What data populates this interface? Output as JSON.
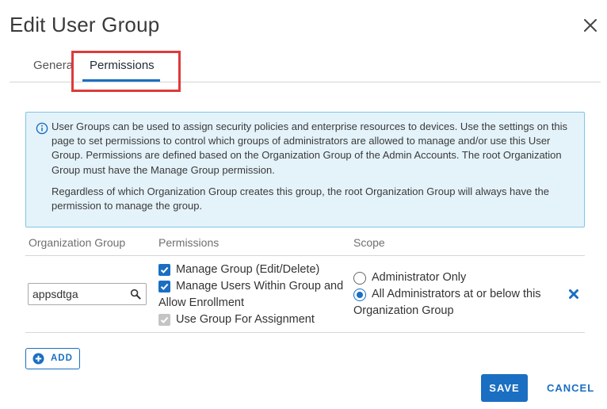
{
  "dialog": {
    "title": "Edit User Group",
    "close_icon": "close-icon"
  },
  "tabs": [
    {
      "label": "General",
      "active": false
    },
    {
      "label": "Permissions",
      "active": true
    }
  ],
  "info": {
    "icon": "info-icon",
    "paragraph_1": "User Groups can be used to assign security policies and enterprise resources to devices. Use the settings on this page to set permissions to control which groups of administrators are allowed to manage and/or use this User Group. Permissions are defined based on the Organization Group of the Admin Accounts. The root Organization Group must have the Manage Group permission.",
    "paragraph_2": "Regardless of which Organization Group creates this group, the root Organization Group will always have the permission to manage the group."
  },
  "table": {
    "headers": [
      "Organization Group",
      "Permissions",
      "Scope"
    ],
    "row": {
      "organization_group": "appsdtga",
      "permissions": [
        {
          "label": "Manage Group (Edit/Delete)",
          "checked": true,
          "disabled": false
        },
        {
          "label": "Manage Users Within Group and Allow Enrollment",
          "checked": true,
          "disabled": false
        },
        {
          "label": "Use Group For Assignment",
          "checked": true,
          "disabled": true
        }
      ],
      "scope_options": [
        {
          "label": "Administrator Only",
          "selected": false
        },
        {
          "label": "All Administrators at or below this Organization Group",
          "selected": true
        }
      ]
    }
  },
  "buttons": {
    "add_label": "ADD",
    "save_label": "SAVE",
    "cancel_label": "CANCEL"
  },
  "colors": {
    "accent": "#1a6fc2",
    "info_bg": "#e4f3fa",
    "info_border": "#7fc6e4",
    "highlight": "#dd3a3a"
  }
}
